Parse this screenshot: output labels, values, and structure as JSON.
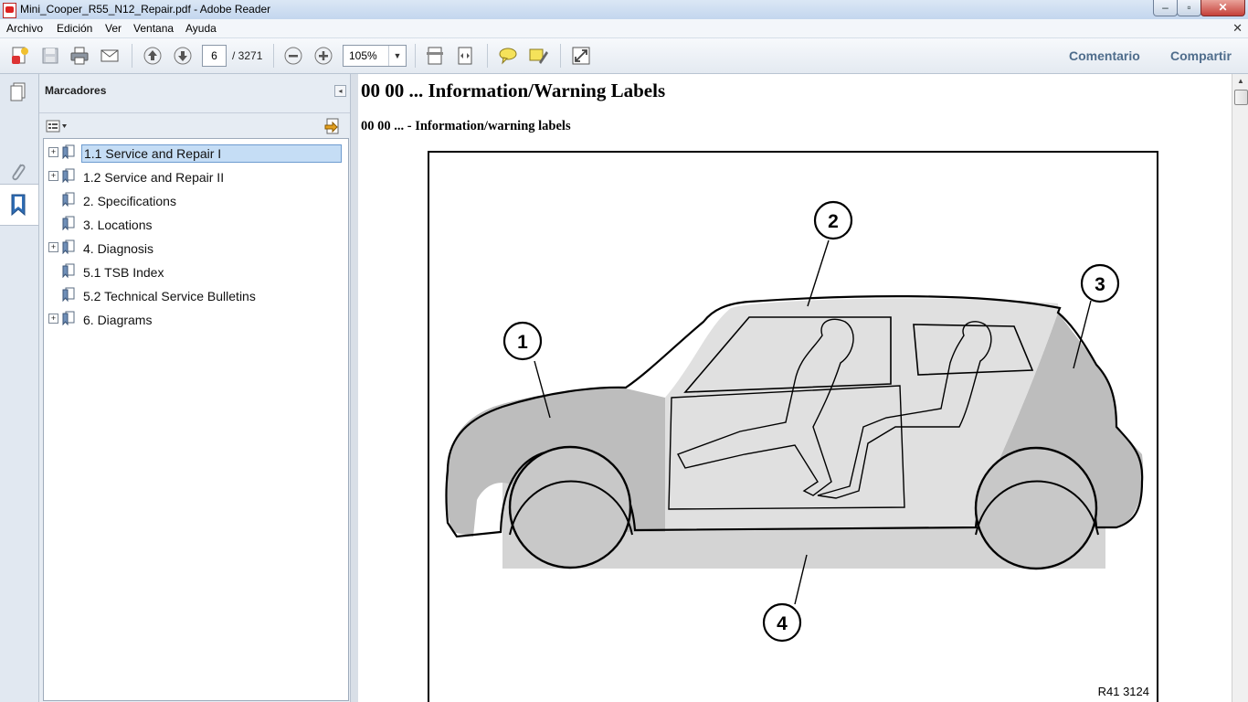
{
  "window": {
    "title": "Mini_Cooper_R55_N12_Repair.pdf - Adobe Reader",
    "minimize": "–",
    "maximize": "▫",
    "close": "✕",
    "doc_close": "✕"
  },
  "menu": {
    "items": [
      "Archivo",
      "Edición",
      "Ver",
      "Ventana",
      "Ayuda"
    ]
  },
  "toolbar": {
    "current_page": "6",
    "page_total": "/ 3271",
    "zoom": "105%",
    "comment_label": "Comentario",
    "share_label": "Compartir"
  },
  "bookmarks": {
    "title": "Marcadores",
    "items": [
      {
        "label": "1.1 Service and Repair I",
        "expandable": true,
        "selected": true
      },
      {
        "label": "1.2 Service and Repair II",
        "expandable": true,
        "selected": false
      },
      {
        "label": "2. Specifications",
        "expandable": false,
        "selected": false
      },
      {
        "label": "3. Locations",
        "expandable": false,
        "selected": false
      },
      {
        "label": "4. Diagnosis",
        "expandable": true,
        "selected": false
      },
      {
        "label": "5.1 TSB Index",
        "expandable": false,
        "selected": false
      },
      {
        "label": "5.2 Technical Service Bulletins",
        "expandable": false,
        "selected": false
      },
      {
        "label": "6. Diagrams",
        "expandable": true,
        "selected": false
      }
    ]
  },
  "document": {
    "heading": "00 00 ... Information/Warning Labels",
    "subheading": "00 00 ... - Information/warning labels",
    "figure": {
      "callouts": [
        "1",
        "2",
        "3",
        "4"
      ],
      "code": "R41 3124"
    }
  },
  "colors": {
    "accent": "#4f6d8c",
    "selection": "#c5ddf5",
    "shade": "#c8c8c8"
  }
}
